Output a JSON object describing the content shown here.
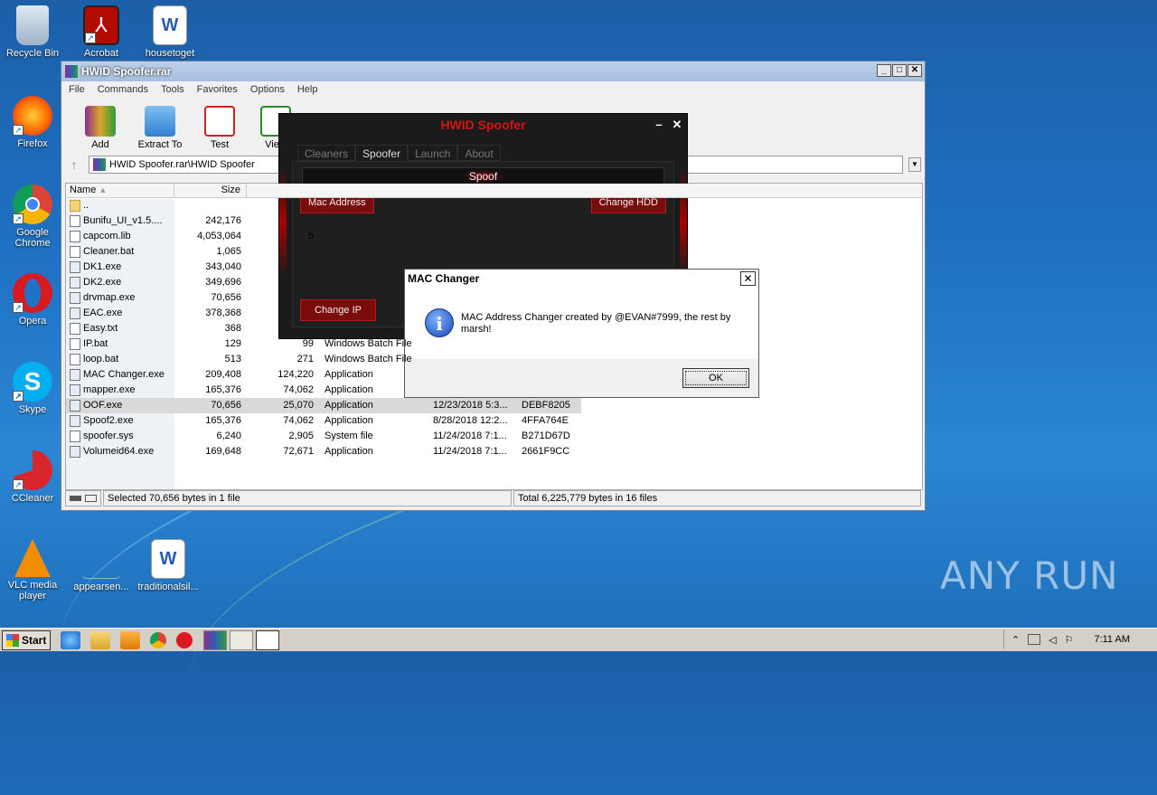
{
  "desktop": {
    "icons": [
      {
        "label": "Recycle Bin"
      },
      {
        "label": "Acrobat"
      },
      {
        "label": "housetoget"
      },
      {
        "label": "Firefox"
      },
      {
        "label": "Google Chrome"
      },
      {
        "label": "Opera"
      },
      {
        "label": "Skype"
      },
      {
        "label": "CCleaner"
      },
      {
        "label": "VLC media player"
      },
      {
        "label": "appearsen..."
      },
      {
        "label": "traditionalsil..."
      }
    ],
    "watermark": "ANY RUN"
  },
  "winrar": {
    "title": "HWID Spoofer.rar",
    "menu": [
      "File",
      "Commands",
      "Tools",
      "Favorites",
      "Options",
      "Help"
    ],
    "toolbar": [
      "Add",
      "Extract To",
      "Test",
      "View"
    ],
    "address": "HWID Spoofer.rar\\HWID Spoofer",
    "columns": {
      "name": "Name",
      "size": "Size"
    },
    "files": [
      {
        "name": "..",
        "size": "",
        "packed": "",
        "type": "",
        "modified": "",
        "crc": "",
        "icon": "folder"
      },
      {
        "name": "Bunifu_UI_v1.5....",
        "size": "242,176",
        "packed": "",
        "type": "",
        "modified": "",
        "crc": "",
        "icon": "file"
      },
      {
        "name": "capcom.lib",
        "size": "4,053,064",
        "packed": "5",
        "type": "",
        "modified": "",
        "crc": "",
        "icon": "file"
      },
      {
        "name": "Cleaner.bat",
        "size": "1,065",
        "packed": "",
        "type": "",
        "modified": "",
        "crc": "",
        "icon": "file"
      },
      {
        "name": "DK1.exe",
        "size": "343,040",
        "packed": "",
        "type": "",
        "modified": "",
        "crc": "",
        "icon": "exe"
      },
      {
        "name": "DK2.exe",
        "size": "349,696",
        "packed": "",
        "type": "",
        "modified": "",
        "crc": "",
        "icon": "exe"
      },
      {
        "name": "drvmap.exe",
        "size": "70,656",
        "packed": "",
        "type": "",
        "modified": "",
        "crc": "",
        "icon": "exe"
      },
      {
        "name": "EAC.exe",
        "size": "378,368",
        "packed": "",
        "type": "",
        "modified": "",
        "crc": "",
        "icon": "exe"
      },
      {
        "name": "Easy.txt",
        "size": "368",
        "packed": "",
        "type": "",
        "modified": "",
        "crc": "",
        "icon": "file"
      },
      {
        "name": "IP.bat",
        "size": "129",
        "packed": "99",
        "type": "Windows Batch File",
        "modified": "",
        "crc": "",
        "icon": "file"
      },
      {
        "name": "loop.bat",
        "size": "513",
        "packed": "271",
        "type": "Windows Batch File",
        "modified": "",
        "crc": "",
        "icon": "file"
      },
      {
        "name": "MAC Changer.exe",
        "size": "209,408",
        "packed": "124,220",
        "type": "Application",
        "modified": "",
        "crc": "",
        "icon": "exe"
      },
      {
        "name": "mapper.exe",
        "size": "165,376",
        "packed": "74,062",
        "type": "Application",
        "modified": "",
        "crc": "",
        "icon": "exe"
      },
      {
        "name": "OOF.exe",
        "size": "70,656",
        "packed": "25,070",
        "type": "Application",
        "modified": "12/23/2018 5:3...",
        "crc": "DEBF8205",
        "icon": "exe",
        "selected": true
      },
      {
        "name": "Spoof2.exe",
        "size": "165,376",
        "packed": "74,062",
        "type": "Application",
        "modified": "8/28/2018 12:2...",
        "crc": "4FFA764E",
        "icon": "exe"
      },
      {
        "name": "spoofer.sys",
        "size": "6,240",
        "packed": "2,905",
        "type": "System file",
        "modified": "11/24/2018 7:1...",
        "crc": "B271D67D",
        "icon": "file"
      },
      {
        "name": "Volumeid64.exe",
        "size": "169,648",
        "packed": "72,671",
        "type": "Application",
        "modified": "11/24/2018 7:1...",
        "crc": "2661F9CC",
        "icon": "exe"
      }
    ],
    "status_left": "Selected 70,656 bytes in 1 file",
    "status_right": "Total 6,225,779 bytes in 16 files"
  },
  "spoofer": {
    "title": "HWID Spoofer",
    "tabs": [
      "Cleaners",
      "Spoofer",
      "Launch",
      "About"
    ],
    "active_tab": 1,
    "bar_label": "Spoof",
    "buttons": {
      "mac": "Mac Address",
      "hdd": "Change HDD",
      "ip": "Change IP"
    },
    "accent": "#7b0c0c"
  },
  "dialog": {
    "title": "MAC Changer",
    "message": "MAC Address Changer created by @EVAN#7999, the rest by marsh!",
    "ok": "OK",
    "icon": "info-icon"
  },
  "taskbar": {
    "start": "Start",
    "clock": "7:11 AM"
  }
}
